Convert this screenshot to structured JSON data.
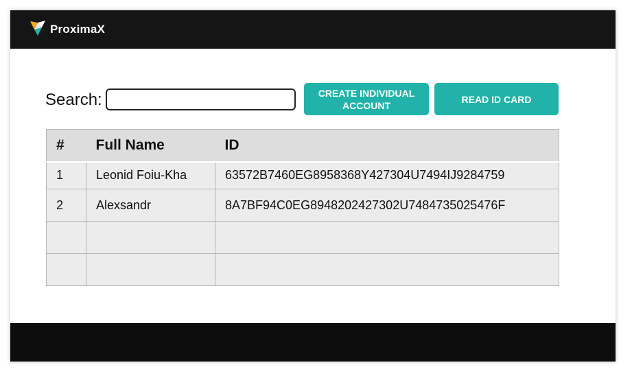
{
  "header": {
    "brand": "ProximaX",
    "logo_icon": "proximax-logo-icon",
    "logo_colors": [
      "#f5a623",
      "#ffffff",
      "#21b3a9"
    ]
  },
  "search": {
    "label": "Search:",
    "value": "",
    "placeholder": ""
  },
  "buttons": {
    "create_label": "CREATE INDIVIDUAL ACCOUNT",
    "read_label": "READ ID CARD"
  },
  "accent_color": "#21b3a9",
  "table": {
    "columns": [
      "#",
      "Full Name",
      "ID"
    ],
    "rows": [
      {
        "num": "1",
        "name": "Leonid Foiu-Kha",
        "id": "63572B7460EG8958368Y427304U7494IJ9284759"
      },
      {
        "num": "2",
        "name": "Alexsandr",
        "id": "8A7BF94C0EG8948202427302U7484735025476F"
      },
      {
        "num": "",
        "name": "",
        "id": ""
      },
      {
        "num": "",
        "name": "",
        "id": ""
      }
    ]
  }
}
